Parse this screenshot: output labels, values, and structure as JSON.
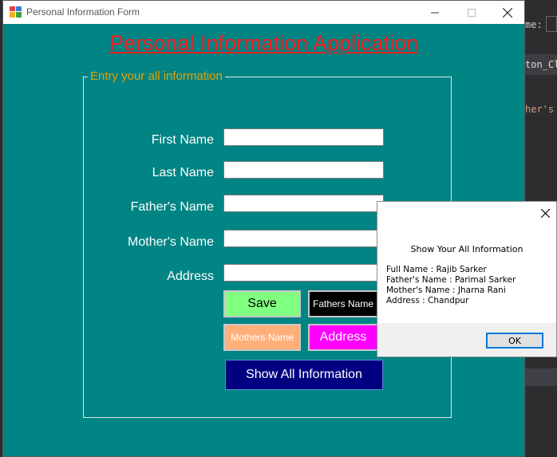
{
  "window": {
    "title": "Personal Information Form"
  },
  "heading": "Personal Information Application",
  "group": {
    "label": "Entry your all information"
  },
  "fields": [
    {
      "label": "First Name",
      "value": ""
    },
    {
      "label": "Last Name",
      "value": ""
    },
    {
      "label": "Father's Name",
      "value": ""
    },
    {
      "label": "Mother's Name",
      "value": ""
    },
    {
      "label": "Address",
      "value": ""
    }
  ],
  "buttons": {
    "save": "Save",
    "fathers_name": "Fathers Name",
    "mothers_name": "Mothers Name",
    "address": "Address",
    "show_all": "Show All Information"
  },
  "message_box": {
    "caption": "Show Your All Information",
    "lines": [
      "Full Name : Rajib Sarker",
      "Father's Name : Parimal Sarker",
      "Mother's Name : Jharna Rani",
      "Address : Chandpur"
    ],
    "ok_label": "OK"
  },
  "background": {
    "snippet_1": "me:",
    "snippet_2": "ton_Cli",
    "snippet_3": "her's N"
  },
  "colors": {
    "form_bg": "#008484",
    "heading": "#ff1c1c",
    "group_label": "#e8a000",
    "save_bg": "#80ff80",
    "fathers_bg": "#000000",
    "mothers_bg": "#ffb07a",
    "address_bg": "#ff00ff",
    "show_all_bg": "#000080"
  },
  "icons": [
    "app-icon",
    "minimize-icon",
    "maximize-icon",
    "close-icon",
    "message-close-icon"
  ]
}
